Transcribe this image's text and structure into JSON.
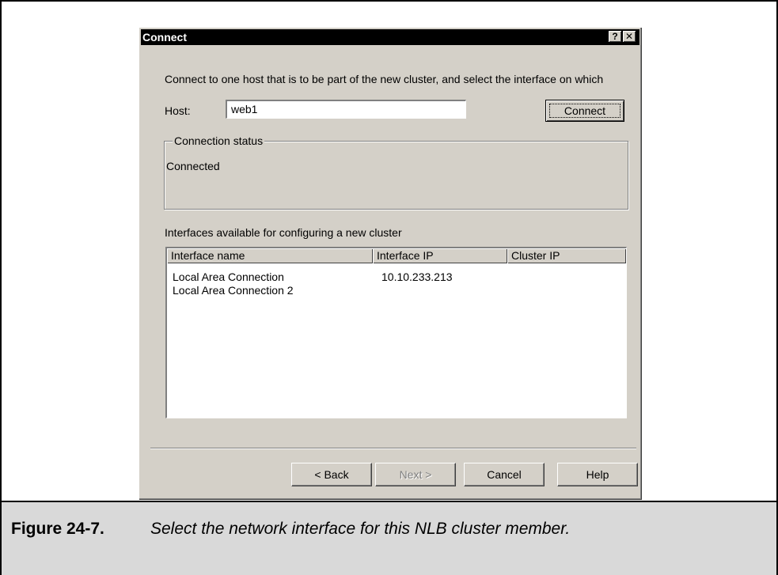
{
  "dialog": {
    "title": "Connect",
    "help_glyph": "?",
    "close_glyph": "✕",
    "instruction": "Connect to one host that is to be part of the new cluster, and select the interface on which",
    "host_label": "Host:",
    "host_value": "web1",
    "connect_label": "Connect",
    "status_group_label": "Connection status",
    "status_text": "Connected",
    "list_label": "Interfaces available for configuring a new cluster",
    "columns": [
      "Interface name",
      "Interface IP",
      "Cluster IP"
    ],
    "rows": [
      [
        "Local Area Connection",
        "10.10.233.213",
        ""
      ],
      [
        "Local Area Connection 2",
        "",
        ""
      ]
    ],
    "buttons": {
      "back": "< Back",
      "next": "Next >",
      "cancel": "Cancel",
      "help": "Help"
    }
  },
  "caption": {
    "number": "Figure 24-7.",
    "text": "Select the network interface for this NLB cluster member."
  }
}
